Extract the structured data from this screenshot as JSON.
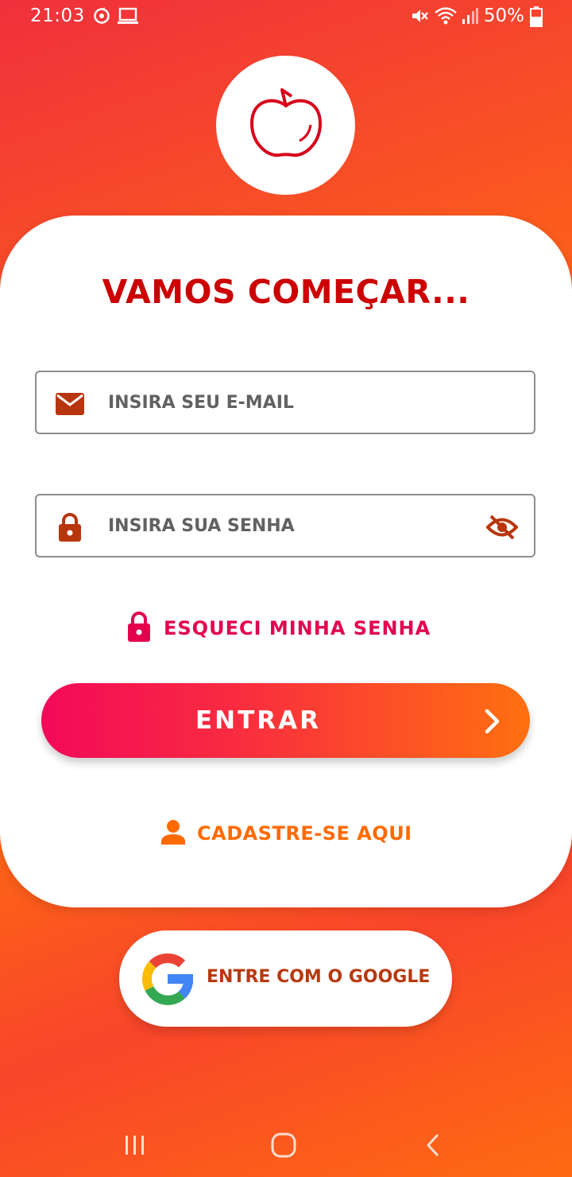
{
  "status_bar": {
    "time": "21:03",
    "battery": "50%",
    "icons": [
      "sync-icon",
      "laptop-icon",
      "mute-icon",
      "wifi-icon",
      "signal-icon",
      "battery-icon"
    ]
  },
  "logo": {
    "icon": "apple-icon"
  },
  "login": {
    "title": "VAMOS COMEÇAR...",
    "email_placeholder": "INSIRA SEU E-MAIL",
    "password_placeholder": "INSIRA SUA SENHA",
    "forgot_label": "ESQUECI MINHA SENHA",
    "enter_label": "ENTRAR",
    "register_label": "CADASTRE-SE AQUI"
  },
  "google": {
    "label": "ENTRE COM O GOOGLE"
  },
  "colors": {
    "title": "#cc0000",
    "icon_brown": "#c0390e",
    "forgot": "#e3004e",
    "register": "#ff6a00",
    "google_text": "#b8390e"
  }
}
